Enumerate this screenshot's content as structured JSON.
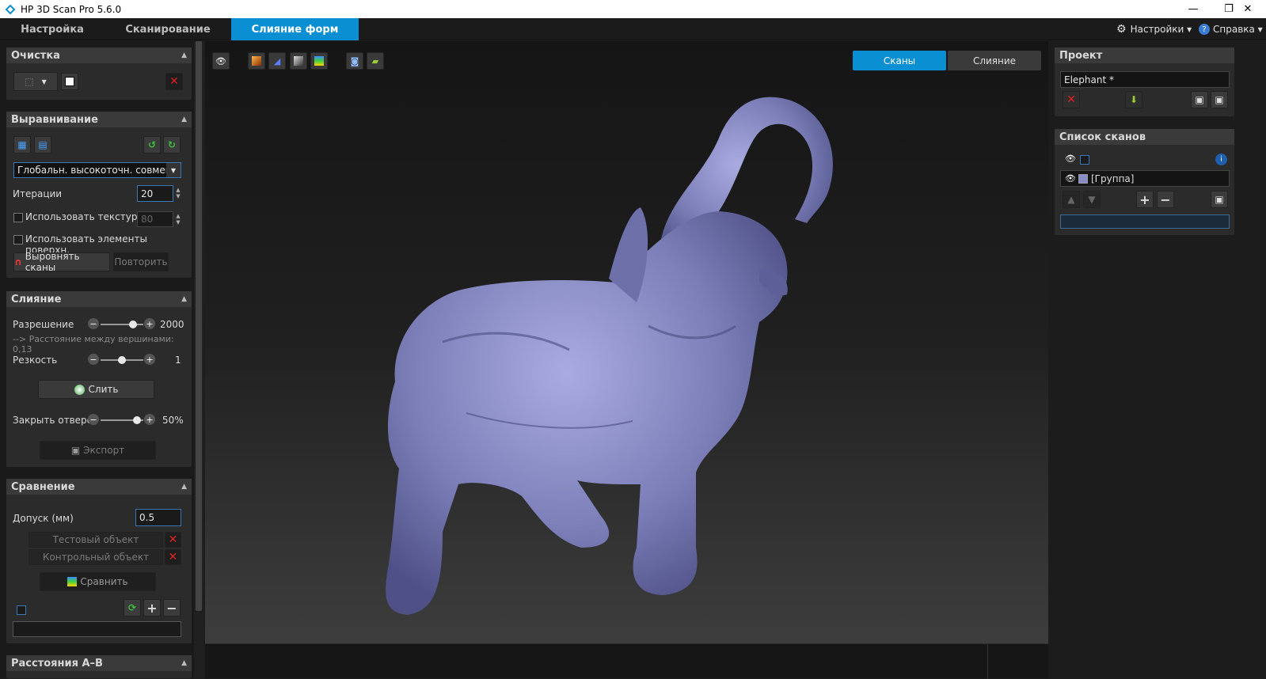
{
  "window": {
    "title": "HP 3D Scan Pro 5.6.0",
    "minimize": "—",
    "restore": "❐",
    "close": "✕"
  },
  "tabs": [
    {
      "label": "Настройка"
    },
    {
      "label": "Сканирование"
    },
    {
      "label": "Слияние форм"
    }
  ],
  "menu": {
    "settings": "Настройки ▾",
    "help": "Справка ▾"
  },
  "cleanup": {
    "title": "Очистка"
  },
  "alignment": {
    "title": "Выравнивание",
    "method": "Глобальн. высокоточн. совмещ.",
    "iterations_label": "Итерации",
    "iterations_value": "20",
    "use_texture_label": "Использовать текстуру",
    "texture_value": "80",
    "use_surface_label": "Использовать элементы поверхн.",
    "align_button": "Выровнять сканы",
    "repeat_button": "Повторить"
  },
  "merge": {
    "title": "Слияние",
    "resolution_label": "Разрешение",
    "resolution_value": "2000",
    "vertex_distance": "--> Расстояние между вершинами: 0,13",
    "sharpness_label": "Резкость",
    "sharpness_value": "1",
    "merge_button": "Слить",
    "close_holes_label": "Закрыть отверстия",
    "close_holes_value": "50%",
    "export_button": "Экспорт",
    "resolution_level": 0.75,
    "sharpness_level": 0.5,
    "holes_level": 0.85
  },
  "compare": {
    "title": "Сравнение",
    "tolerance_label": "Допуск (мм)",
    "tolerance_value": "0.5",
    "test_object": "Тестовый объект",
    "control_object": "Контрольный объект",
    "compare_button": "Сравнить"
  },
  "distances": {
    "title": "Расстояния A–B"
  },
  "viewport": {
    "scans_tab": "Сканы",
    "merge_tab": "Слияние"
  },
  "project": {
    "title": "Проект",
    "name": "Elephant *"
  },
  "scanlist": {
    "title": "Список сканов",
    "group": "[Группа]"
  },
  "colors": {
    "accent": "#0b8fd3",
    "model": "#8a8cc8"
  }
}
